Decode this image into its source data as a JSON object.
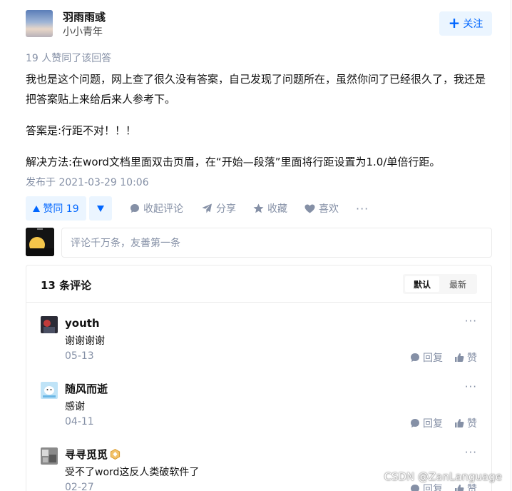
{
  "author": {
    "name": "羽雨雨彧",
    "headline": "小小青年",
    "follow_label": "关注"
  },
  "answer": {
    "vote_summary": "19 人赞同了该回答",
    "paragraphs": [
      "我也是这个问题，网上查了很久没有答案，自己发现了问题所在，虽然你问了已经很久了，我还是把答案贴上来给后来人参考下。",
      "答案是:行距不对！！！",
      "解决方法:在word文档里面双击页眉，在“开始—段落”里面将行距设置为1.0/单倍行距。"
    ],
    "published": "发布于 2021-03-29 10:06"
  },
  "actions": {
    "vote_up_label": "赞同 19",
    "collapse_comments": "收起评论",
    "share": "分享",
    "favorite": "收藏",
    "like": "喜欢",
    "more": "···"
  },
  "comment_editor": {
    "placeholder": "评论千万条，友善第一条"
  },
  "comments": {
    "count_label": "13 条评论",
    "sort_default": "默认",
    "sort_latest": "最新",
    "reply_label": "回复",
    "like_label": "赞",
    "more_label": "···",
    "items": [
      {
        "name": "youth",
        "text": "谢谢谢谢",
        "date": "05-13"
      },
      {
        "name": "随风而逝",
        "text": "感谢",
        "date": "04-11"
      },
      {
        "name": "寻寻觅觅",
        "text": "受不了word这反人类破软件了",
        "date": "02-27"
      }
    ]
  },
  "colors": {
    "accent": "#0066ff",
    "accent_bg": "#ebf5ff",
    "muted": "#8590a6",
    "border": "#ebebeb"
  },
  "watermark": "CSDN @ZanLanguage"
}
